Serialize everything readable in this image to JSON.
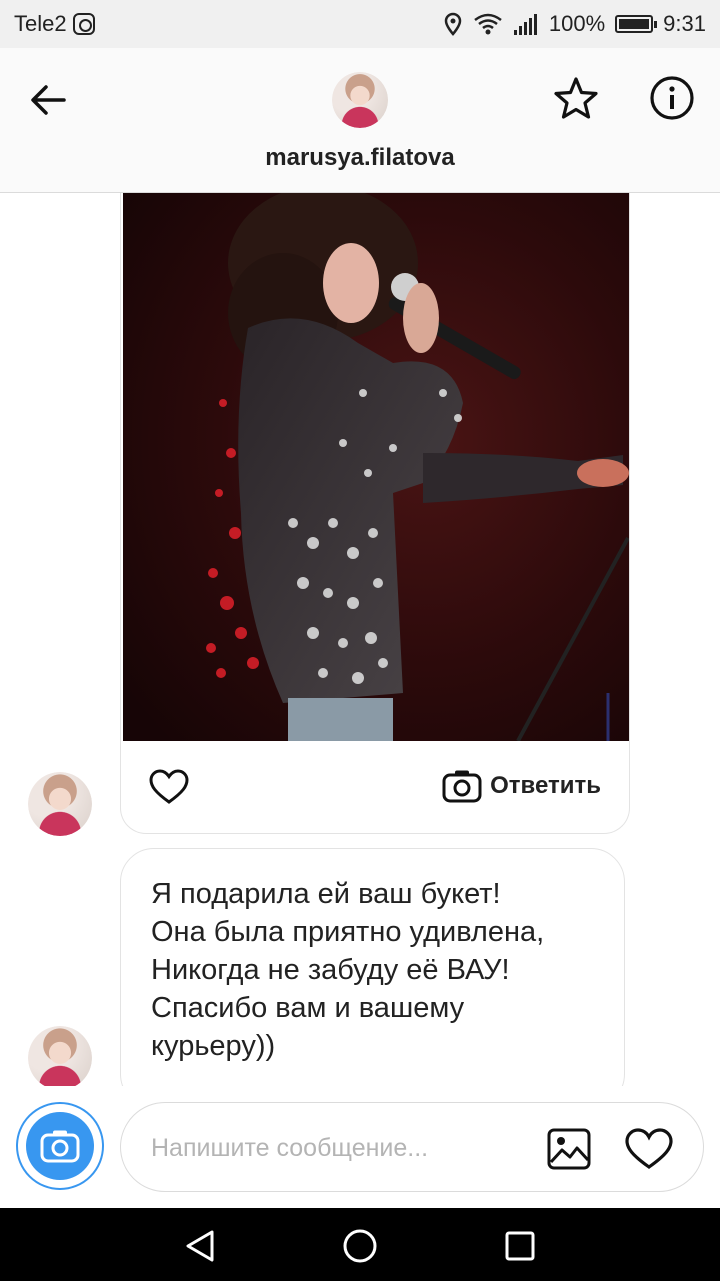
{
  "status_bar": {
    "carrier": "Tele2",
    "battery": "100%",
    "time": "9:31",
    "icons": [
      "instagram-icon",
      "location-icon",
      "wifi-icon",
      "signal-icon",
      "battery-icon"
    ]
  },
  "header": {
    "username": "marusya.filatova",
    "icons": [
      "back-arrow-icon",
      "star-icon",
      "info-icon"
    ]
  },
  "thread": {
    "media_message": {
      "reply_label": "Ответить",
      "icons": [
        "heart-icon",
        "camera-icon"
      ]
    },
    "text_message": {
      "lines": [
        "Я подарила ей ваш букет!",
        "Она была приятно удивлена,",
        "Никогда не забуду её ВАУ!",
        "Спасибо вам и вашему",
        "курьеру))"
      ]
    }
  },
  "composer": {
    "placeholder": "Напишите сообщение...",
    "value": "",
    "icons": [
      "camera-icon",
      "image-icon",
      "heart-icon"
    ]
  },
  "nav_bar": {
    "icons": [
      "back-triangle-icon",
      "home-circle-icon",
      "recents-square-icon"
    ]
  },
  "colors": {
    "accent": "#3897f0",
    "header_bg": "#fafafa",
    "status_bg": "#f0f0f0",
    "border": "#dbdbdb",
    "nav_bg": "#000000"
  }
}
